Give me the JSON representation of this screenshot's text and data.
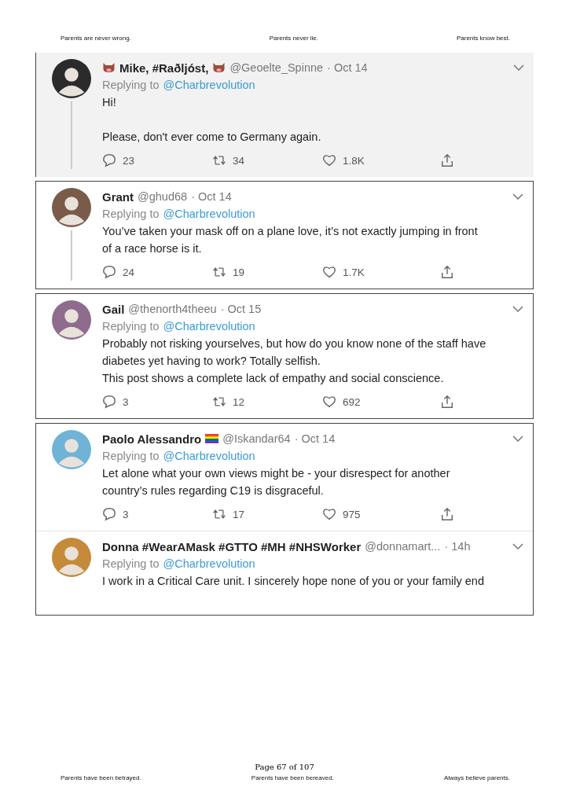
{
  "header": [
    "Parents are never wrong.",
    "Parents never lie.",
    "Parents know best."
  ],
  "cards": [
    {
      "shaded": true,
      "framed": false,
      "tweets": [
        {
          "name": "Mike, #Raðljóst,",
          "flair": {
            "kind": "boar"
          },
          "handle": "@Geoelte_Spinne",
          "time": "· Oct 14",
          "replying": "Replying to",
          "reply_to": "@Charbrevolution",
          "lines": [
            "Hi!"
          ],
          "lines_after_gap": [
            "Please, don't ever come to Germany again."
          ],
          "replies": "23",
          "retweets": "34",
          "likes": "1.8K",
          "thread": true
        }
      ]
    },
    {
      "shaded": false,
      "framed": true,
      "tweets": [
        {
          "name": "Grant",
          "handle": "@ghud68",
          "time": "· Oct 14",
          "replying": "Replying to",
          "reply_to": "@Charbrevolution",
          "lines": [
            "You’ve taken your mask off on a plane love, it’s not exactly jumping in front",
            "of a race horse is it."
          ],
          "replies": "24",
          "retweets": "19",
          "likes": "1.7K",
          "thread": true
        }
      ]
    },
    {
      "shaded": false,
      "framed": true,
      "tweets": [
        {
          "name": "Gail",
          "handle": "@thenorth4theeu",
          "time": "· Oct 15",
          "replying": "Replying to",
          "reply_to": "@Charbrevolution",
          "lines": [
            "Probably not risking yourselves, but how do you know none of the staff have",
            "diabetes yet having to work? Totally selfish.",
            "This post shows a complete lack of empathy and social conscience."
          ],
          "replies": "3",
          "retweets": "12",
          "likes": "692",
          "thread": false
        }
      ]
    },
    {
      "shaded": false,
      "framed": true,
      "tweets": [
        {
          "name": "Paolo Alessandro",
          "flair": {
            "kind": "rainbow"
          },
          "handle": "@Iskandar64",
          "time": "· Oct 14",
          "replying": "Replying to",
          "reply_to": "@Charbrevolution",
          "lines": [
            "Let alone what your own views might be - your disrespect for another",
            "country’s rules regarding C19 is disgraceful."
          ],
          "replies": "3",
          "retweets": "17",
          "likes": "975",
          "thread": false
        },
        {
          "name": "Donna #WearAMask #GTTO #MH #NHSWorker",
          "handle": "@donnamart...",
          "time": "· 14h",
          "replying": "Replying to",
          "reply_to": "@Charbrevolution",
          "lines": [
            "I work in a Critical Care unit. I sincerely hope none of you or your family end"
          ],
          "thread": false
        }
      ]
    }
  ],
  "page_number": "Page 67 of 107",
  "footer": [
    "Parents have been betrayed.",
    "Parents have been bereaved.",
    "Always believe parents."
  ]
}
